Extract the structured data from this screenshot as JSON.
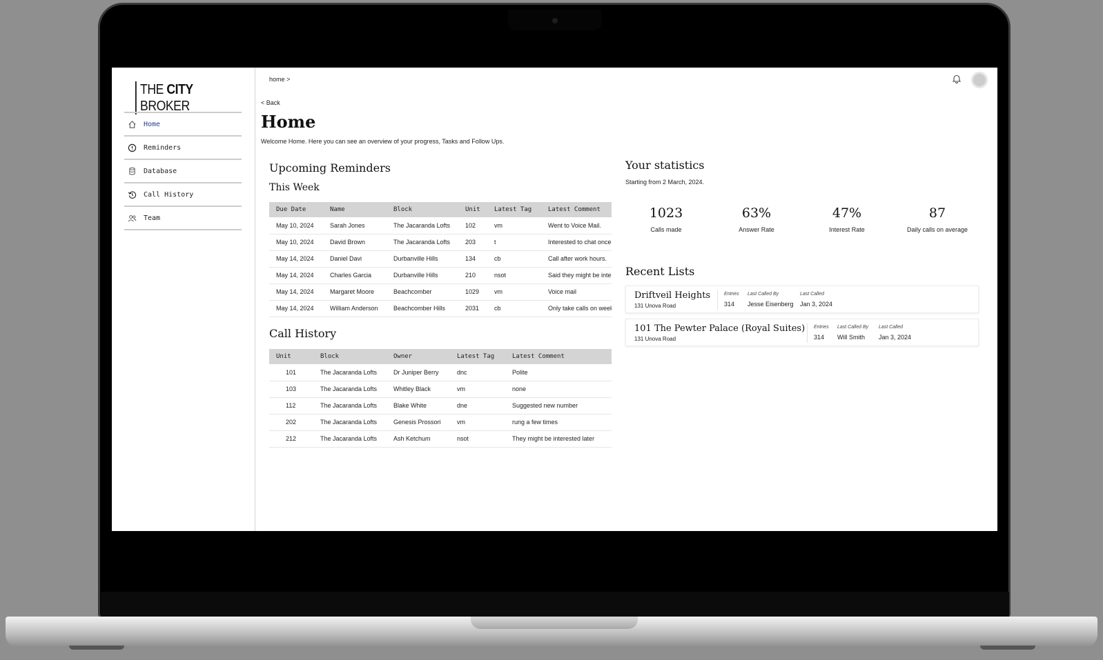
{
  "brand": {
    "prefix": "THE ",
    "bold": "CITY",
    "suffix": " BROKER"
  },
  "sidebar": {
    "items": [
      {
        "label": "Home",
        "icon": "home-icon"
      },
      {
        "label": "Reminders",
        "icon": "alert-circle-icon"
      },
      {
        "label": "Database",
        "icon": "database-icon"
      },
      {
        "label": "Call History",
        "icon": "history-icon"
      },
      {
        "label": "Team",
        "icon": "team-icon"
      }
    ]
  },
  "header": {
    "breadcrumb": "home >",
    "back": "< Back",
    "title": "Home",
    "subtitle": "Welcome Home. Here you can see an overview of your progress, Tasks and Follow Ups."
  },
  "reminders": {
    "heading": "Upcoming Reminders",
    "subheading": "This Week",
    "columns": [
      "Due Date",
      "Name",
      "Block",
      "Unit",
      "Latest Tag",
      "Latest Comment"
    ],
    "rows": [
      [
        "May 10, 2024",
        "Sarah Jones",
        "The Jacaranda Lofts",
        "102",
        "vm",
        "Went to Voice Mail."
      ],
      [
        "May 10, 2024",
        "David Brown",
        "The Jacaranda Lofts",
        "203",
        "t",
        "Interested to chat once"
      ],
      [
        "May 14, 2024",
        "Daniel Davi",
        "Durbanville Hills",
        "134",
        "cb",
        "Call after work hours."
      ],
      [
        "May 14, 2024",
        "Charles Garcia",
        "Durbanville Hills",
        "210",
        "nsot",
        "Said they might be inter"
      ],
      [
        "May 14, 2024",
        "Margaret Moore",
        "Beachcomber",
        "1029",
        "vm",
        "Voice mail"
      ],
      [
        "May 14, 2024",
        "William Anderson",
        "Beachcomber Hills",
        "2031",
        "cb",
        "Only take calls on week"
      ]
    ]
  },
  "call_history": {
    "heading": "Call History",
    "columns": [
      "Unit",
      "Block",
      "Owner",
      "Latest Tag",
      "Latest Comment"
    ],
    "rows": [
      [
        "101",
        "The Jacaranda Lofts",
        "Dr Juniper Berry",
        "dnc",
        "Polite"
      ],
      [
        "103",
        "The Jacaranda Lofts",
        "Whitley Black",
        "vm",
        "none"
      ],
      [
        "112",
        "The Jacaranda Lofts",
        "Blake White",
        "dne",
        "Suggested new number"
      ],
      [
        "202",
        "The Jacaranda Lofts",
        "Genesis Prossori",
        "vm",
        "rung a few times"
      ],
      [
        "212",
        "The Jacaranda Lofts",
        "Ash Ketchum",
        "nsot",
        "They might be interested later"
      ]
    ]
  },
  "statistics": {
    "heading": "Your statistics",
    "since": "Starting from 2 March, 2024.",
    "items": [
      {
        "value": "1023",
        "label": "Calls made"
      },
      {
        "value": "63%",
        "label": "Answer Rate"
      },
      {
        "value": "47%",
        "label": "Interest Rate"
      },
      {
        "value": "87",
        "label": "Daily calls on average"
      }
    ]
  },
  "recent_lists": {
    "heading": "Recent Lists",
    "labels": {
      "entries": "Entries",
      "last_called_by": "Last Called By",
      "last_called": "Last Called"
    },
    "items": [
      {
        "name": "Driftveil Heights",
        "address": "131 Unova Road",
        "entries": "314",
        "last_called_by": "Jesse Eisenberg",
        "last_called": "Jan 3, 2024"
      },
      {
        "name": "101 The Pewter Palace (Royal Suites)",
        "address": "131 Unova Road",
        "entries": "314",
        "last_called_by": "Will Smith",
        "last_called": "Jan 3, 2024"
      }
    ]
  },
  "colors": {
    "active_nav": "#2b3a8a",
    "table_header": "#d4d4d4"
  }
}
